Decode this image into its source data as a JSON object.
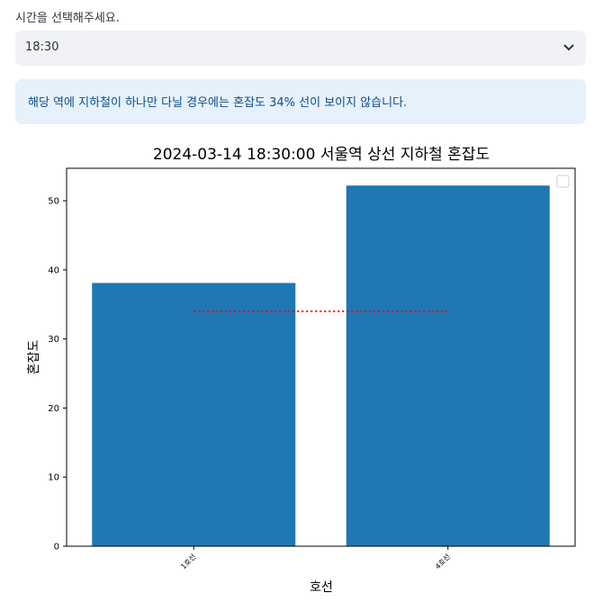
{
  "select": {
    "label": "시간을 선택해주세요.",
    "value": "18:30",
    "chevron_icon": "chevron-down-icon"
  },
  "info": {
    "message": "해당 역에 지하철이 하나만 다닐 경우에는 혼잡도 34% 선이 보이지 않습니다."
  },
  "chart_data": {
    "type": "bar",
    "title": "2024-03-14 18:30:00 서울역 상선 지하철 혼잡도",
    "categories": [
      "1호선",
      "4호선"
    ],
    "values": [
      38.1,
      52.2
    ],
    "xlabel": "호선",
    "ylabel": "혼잡도",
    "ylim": [
      0,
      54.7
    ],
    "yticks": [
      0,
      10,
      20,
      30,
      40,
      50
    ],
    "reference_line": {
      "value": 34,
      "style": "dotted",
      "color": "#ff0000"
    },
    "bar_color": "#1f77b4",
    "legend": {
      "placement": "top-right",
      "entries": []
    },
    "grid": false
  }
}
